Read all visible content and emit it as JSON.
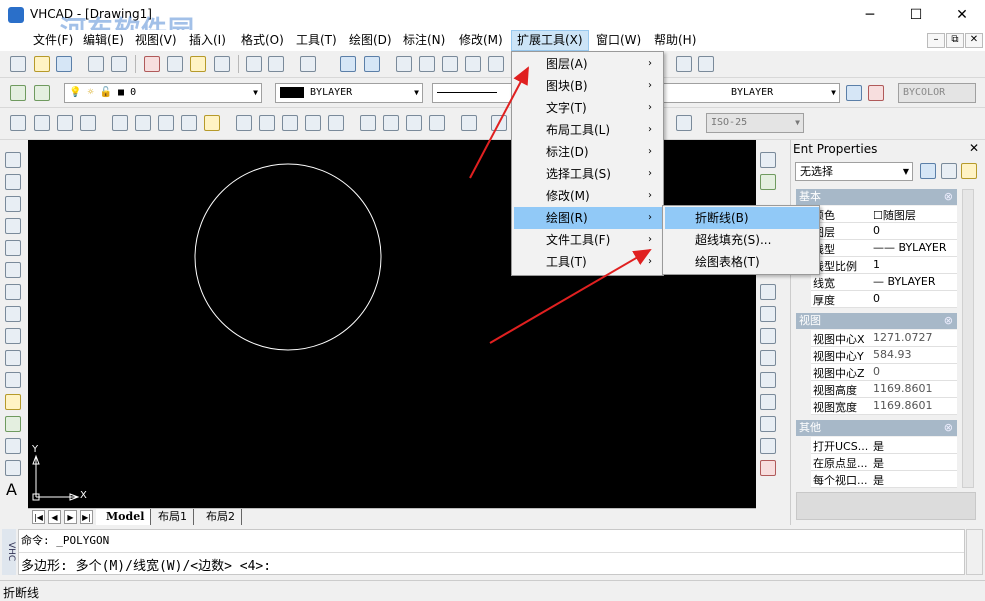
{
  "window": {
    "title": "VHCAD - [Drawing1]",
    "minimize": "─",
    "maximize": "☐",
    "close": "✕",
    "watermark": "河东软件园",
    "watermark_url": "www.pc0359.cn"
  },
  "menubar": {
    "items": [
      {
        "label": "文件(F)"
      },
      {
        "label": "编辑(E)"
      },
      {
        "label": "视图(V)"
      },
      {
        "label": "插入(I)"
      },
      {
        "label": "格式(O)"
      },
      {
        "label": "工具(T)"
      },
      {
        "label": "绘图(D)"
      },
      {
        "label": "标注(N)"
      },
      {
        "label": "修改(M)"
      },
      {
        "label": "扩展工具(X)"
      },
      {
        "label": "窗口(W)"
      },
      {
        "label": "帮助(H)"
      }
    ],
    "mdi": {
      "minimize": "–",
      "restore": "⧉",
      "close": "✕"
    }
  },
  "toolbar2": {
    "layer_value": "0",
    "color_value": "BYLAYER",
    "linetype_value": "BYLAYER",
    "plotstyle_value": "BYCOLOR"
  },
  "toolbar3": {
    "dimstyle_value": "ISO-25"
  },
  "ext_menu": {
    "items": [
      {
        "label": "图层(A)",
        "arrow": "›"
      },
      {
        "label": "图块(B)",
        "arrow": "›"
      },
      {
        "label": "文字(T)",
        "arrow": "›"
      },
      {
        "label": "布局工具(L)",
        "arrow": "›"
      },
      {
        "label": "标注(D)",
        "arrow": "›"
      },
      {
        "label": "选择工具(S)",
        "arrow": "›"
      },
      {
        "label": "修改(M)",
        "arrow": "›"
      },
      {
        "label": "绘图(R)",
        "arrow": "›"
      },
      {
        "label": "文件工具(F)",
        "arrow": "›"
      },
      {
        "label": "工具(T)",
        "arrow": "›"
      }
    ],
    "highlighted": "绘图(R)"
  },
  "draw_submenu": {
    "items": [
      {
        "label": "折断线(B)"
      },
      {
        "label": "超线填充(S)..."
      },
      {
        "label": "绘图表格(T)"
      }
    ],
    "highlighted": "折断线(B)"
  },
  "canvas": {
    "ucs_x": "X",
    "ucs_y": "Y",
    "background": "#000000",
    "circle_color": "#ffffff"
  },
  "layout_tabs": {
    "nav": [
      "|◀",
      "◀",
      "▶",
      "▶|"
    ],
    "tabs": [
      "Model",
      "布局1",
      "布局2"
    ],
    "active": "Model"
  },
  "properties": {
    "title": "Ent Properties",
    "close": "✕",
    "selection": "无选择",
    "sections": [
      {
        "name": "基本",
        "rows": [
          {
            "key": "颜色",
            "value": "☐随图层"
          },
          {
            "key": "图层",
            "value": "0"
          },
          {
            "key": "线型",
            "value": "—— BYLAYER"
          },
          {
            "key": "线型比例",
            "value": "1"
          },
          {
            "key": "线宽",
            "value": "— BYLAYER"
          },
          {
            "key": "厚度",
            "value": "0"
          }
        ]
      },
      {
        "name": "视图",
        "rows": [
          {
            "key": "视图中心X",
            "value": "1271.0727"
          },
          {
            "key": "视图中心Y",
            "value": "584.93"
          },
          {
            "key": "视图中心Z",
            "value": "0"
          },
          {
            "key": "视图高度",
            "value": "1169.8601"
          },
          {
            "key": "视图宽度",
            "value": "1169.8601"
          }
        ]
      },
      {
        "name": "其他",
        "rows": [
          {
            "key": "打开UCS...",
            "value": "是"
          },
          {
            "key": "在原点显...",
            "value": "是"
          },
          {
            "key": "每个视口...",
            "value": "是"
          }
        ]
      }
    ],
    "collapse_glyph": "⊗"
  },
  "command": {
    "tag": "VHC",
    "line1": "命令: _POLYGON",
    "line2": "多边形:  多个(M)/线宽(W)/<边数> <4>:"
  },
  "status": {
    "text": "折断线"
  },
  "colors": {
    "menu_highlight": "#91c9f7",
    "arrow_red": "#e02020",
    "section_header": "#a7b8c8"
  }
}
